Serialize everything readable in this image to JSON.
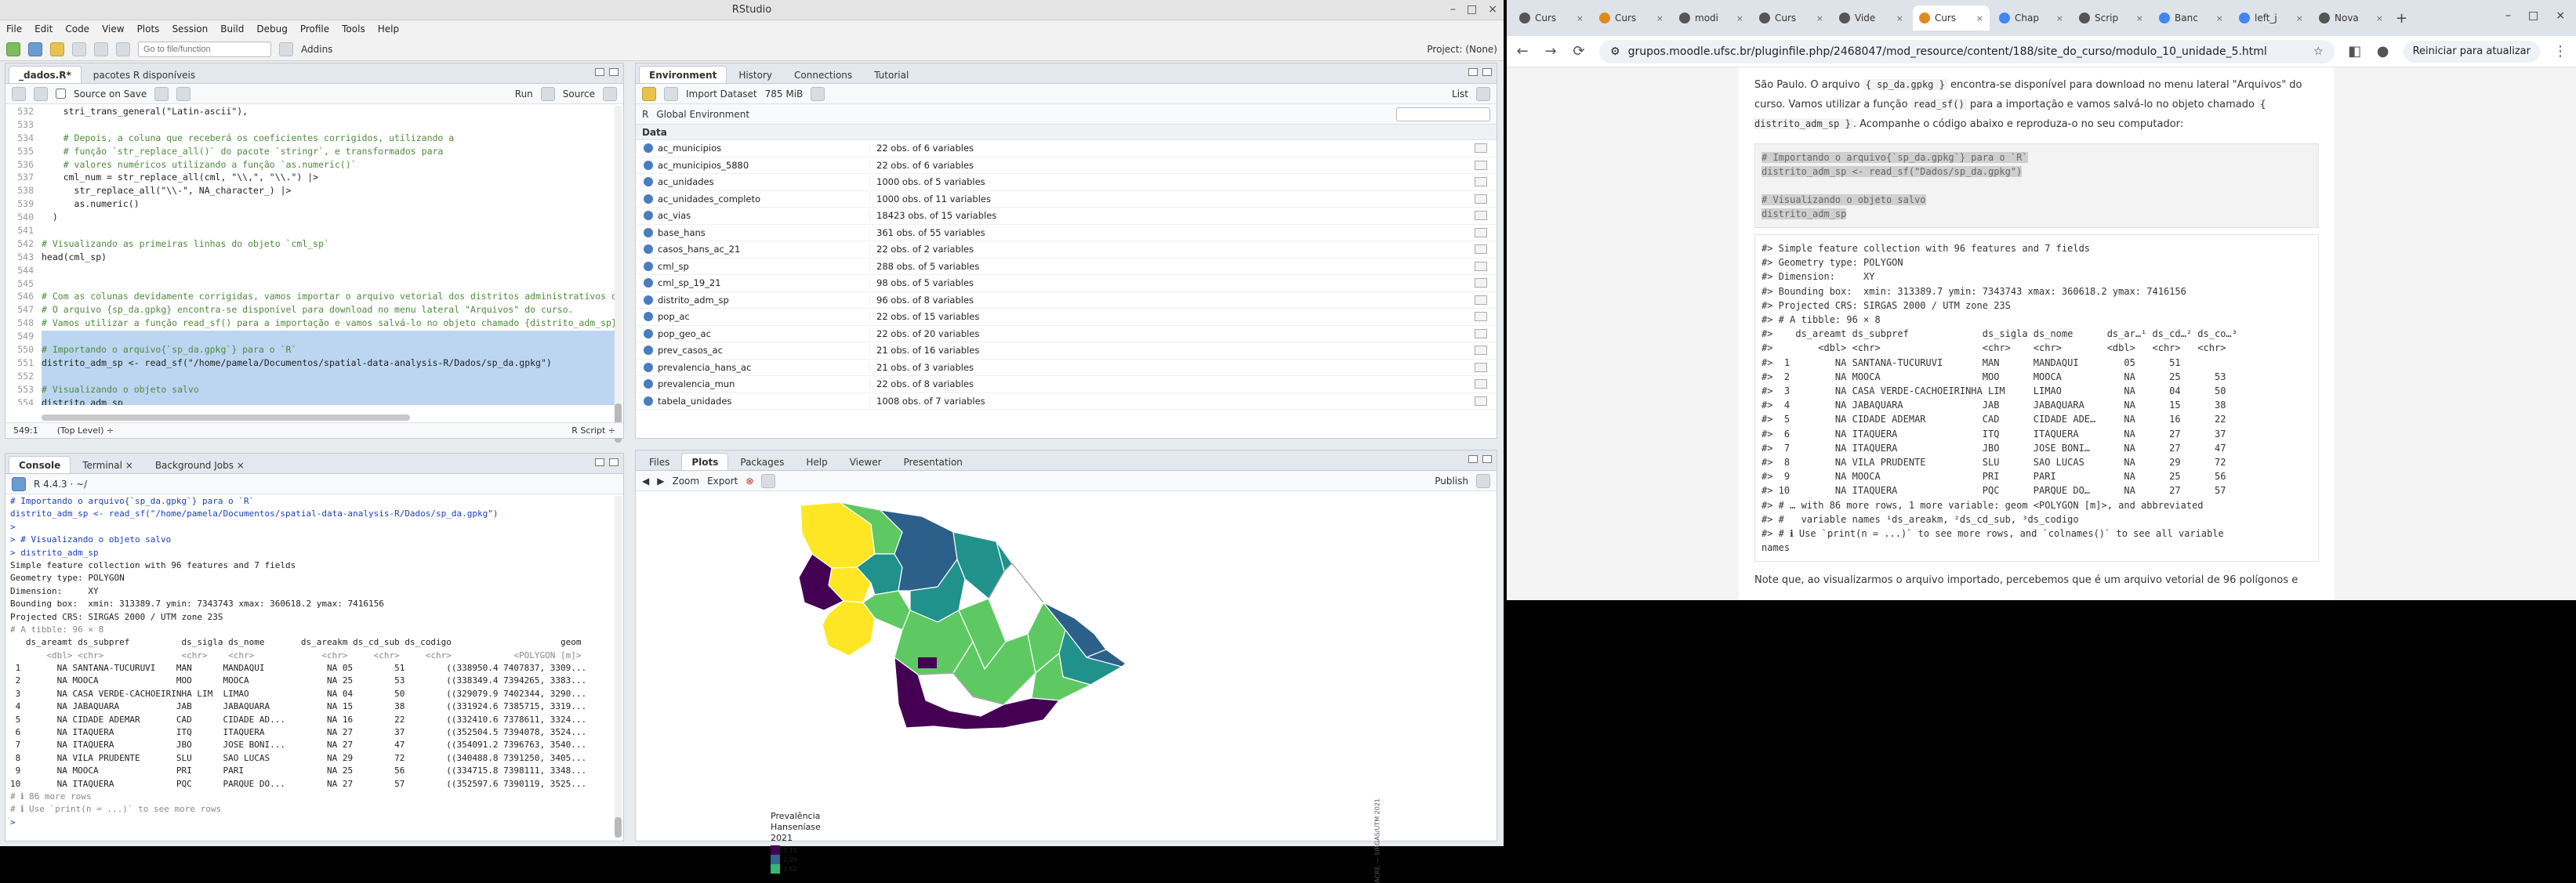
{
  "rstudio": {
    "title": "RStudio",
    "menu": [
      "File",
      "Edit",
      "Code",
      "View",
      "Plots",
      "Session",
      "Build",
      "Debug",
      "Profile",
      "Tools",
      "Help"
    ],
    "toolbar": {
      "goto_placeholder": "Go to file/function",
      "addins": "Addins",
      "project": "Project: (None)"
    },
    "editor": {
      "tabs": [
        "_dados.R*",
        "pacotes R disponíveis"
      ],
      "source_on_save": "Source on Save",
      "run": "Run",
      "source": "Source",
      "lines": [
        {
          "n": "532",
          "t": "    stri_trans_general(\"Latin-ascii\"),",
          "c": ""
        },
        {
          "n": "533",
          "t": "",
          "c": ""
        },
        {
          "n": "534",
          "t": "    # Depois, a coluna que receberá os coeficientes corrigidos, utilizando a",
          "c": "cm"
        },
        {
          "n": "535",
          "t": "    # função `str_replace_all()` do pacote `stringr`, e transformados para",
          "c": "cm"
        },
        {
          "n": "536",
          "t": "    # valores numéricos utilizando a função `as.numeric()`",
          "c": "cm"
        },
        {
          "n": "537",
          "t": "    cml_num = str_replace_all(cml, \"\\\\,\", \"\\\\.\") |>",
          "c": ""
        },
        {
          "n": "538",
          "t": "      str_replace_all(\"\\\\-\", NA_character_) |>",
          "c": ""
        },
        {
          "n": "539",
          "t": "      as.numeric()",
          "c": ""
        },
        {
          "n": "540",
          "t": "  )",
          "c": ""
        },
        {
          "n": "541",
          "t": "",
          "c": ""
        },
        {
          "n": "542",
          "t": "# Visualizando as primeiras linhas do objeto `cml_sp`",
          "c": "cm"
        },
        {
          "n": "543",
          "t": "head(cml_sp)",
          "c": ""
        },
        {
          "n": "544",
          "t": "",
          "c": ""
        },
        {
          "n": "545",
          "t": "",
          "c": ""
        },
        {
          "n": "546",
          "t": "# Com as colunas devidamente corrigidas, vamos importar o arquivo vetorial dos distritos administrativos de S",
          "c": "cm"
        },
        {
          "n": "547",
          "t": "# O arquivo {sp_da.gpkg} encontra-se disponível para download no menu lateral \"Arquivos\" do curso.",
          "c": "cm"
        },
        {
          "n": "548",
          "t": "# Vamos utilizar a função read_sf() para a importação e vamos salvá-lo no objeto chamado {distrito_adm_sp}.",
          "c": "cm"
        },
        {
          "n": "549",
          "t": "",
          "c": "sel"
        },
        {
          "n": "550",
          "t": "# Importando o arquivo{`sp_da.gpkg`} para o `R`",
          "c": "sel cm"
        },
        {
          "n": "551",
          "t": "distrito_adm_sp <- read_sf(\"/home/pamela/Documentos/spatial-data-analysis-R/Dados/sp_da.gpkg\")",
          "c": "sel"
        },
        {
          "n": "552",
          "t": "",
          "c": "sel"
        },
        {
          "n": "553",
          "t": "# Visualizando o objeto salvo",
          "c": "sel cm"
        },
        {
          "n": "554",
          "t": "distrito_adm_sp",
          "c": "sel"
        },
        {
          "n": "555",
          "t": "",
          "c": ""
        }
      ],
      "status_pos": "549:1",
      "status_level": "(Top Level) ÷",
      "status_type": "R Script ÷"
    },
    "console": {
      "tabs": [
        "Console",
        "Terminal ×",
        "Background Jobs ×"
      ],
      "version": "R 4.4.3 · ~/",
      "lines": [
        {
          "t": "# Importando o arquivo{`sp_da.gpkg`} para o `R`",
          "k": "cmd"
        },
        {
          "t": "distrito_adm_sp <- read_sf(\"/home/pamela/Documentos/spatial-data-analysis-R/Dados/sp_da.gpkg\")",
          "k": "cmd"
        },
        {
          "t": ">",
          "k": "cmd"
        },
        {
          "t": "> # Visualizando o objeto salvo",
          "k": "cmd"
        },
        {
          "t": "> distrito_adm_sp",
          "k": "cmd"
        },
        {
          "t": "Simple feature collection with 96 features and 7 fields",
          "k": ""
        },
        {
          "t": "Geometry type: POLYGON",
          "k": ""
        },
        {
          "t": "Dimension:     XY",
          "k": ""
        },
        {
          "t": "Bounding box:  xmin: 313389.7 ymin: 7343743 xmax: 360618.2 ymax: 7416156",
          "k": ""
        },
        {
          "t": "Projected CRS: SIRGAS 2000 / UTM zone 23S",
          "k": ""
        },
        {
          "t": "# A tibble: 96 × 8",
          "k": "dim"
        },
        {
          "t": "   ds_areamt ds_subpref          ds_sigla ds_nome       ds_areakm ds_cd_sub ds_codigo                     geom",
          "k": ""
        },
        {
          "t": "       <dbl> <chr>               <chr>    <chr>             <chr>     <chr>     <chr>            <POLYGON [m]>",
          "k": "dim"
        },
        {
          "t": " 1       NA SANTANA-TUCURUVI    MAN      MANDAQUI            NA 05        51        ((338950.4 7407837, 3309...",
          "k": ""
        },
        {
          "t": " 2       NA MOOCA               MOO      MOOCA               NA 25        53        ((338349.4 7394265, 3383...",
          "k": ""
        },
        {
          "t": " 3       NA CASA VERDE-CACHOEIRINHA LIM  LIMAO               NA 04        50        ((329079.9 7402344, 3290...",
          "k": ""
        },
        {
          "t": " 4       NA JABAQUARA           JAB      JABAQUARA           NA 15        38        ((331924.6 7385715, 3319...",
          "k": ""
        },
        {
          "t": " 5       NA CIDADE ADEMAR       CAD      CIDADE AD...        NA 16        22        ((332410.6 7378611, 3324...",
          "k": ""
        },
        {
          "t": " 6       NA ITAQUERA            ITQ      ITAQUERA            NA 27        37        ((352504.5 7394078, 3524...",
          "k": ""
        },
        {
          "t": " 7       NA ITAQUERA            JBO      JOSE BONI...        NA 27        47        ((354091.2 7396763, 3540...",
          "k": ""
        },
        {
          "t": " 8       NA VILA PRUDENTE       SLU      SAO LUCAS           NA 29        72        ((340488.8 7391250, 3405...",
          "k": ""
        },
        {
          "t": " 9       NA MOOCA               PRI      PARI                NA 25        56        ((334715.8 7398111, 3348...",
          "k": ""
        },
        {
          "t": "10       NA ITAQUERA            PQC      PARQUE DO...        NA 27        57        ((352597.6 7390119, 3525...",
          "k": ""
        },
        {
          "t": "# ℹ 86 more rows",
          "k": "dim"
        },
        {
          "t": "# ℹ Use `print(n = ...)` to see more rows",
          "k": "dim"
        },
        {
          "t": ">",
          "k": "cmd"
        }
      ]
    },
    "environment": {
      "tabs": [
        "Environment",
        "History",
        "Connections",
        "Tutorial"
      ],
      "import_dataset": "Import Dataset",
      "memory": "785 MiB",
      "list_view": "List",
      "r_selector": "R",
      "scope": "Global Environment",
      "section": "Data",
      "rows": [
        {
          "name": "ac_municipios",
          "value": "22 obs. of 6 variables"
        },
        {
          "name": "ac_municipios_5880",
          "value": "22 obs. of 6 variables"
        },
        {
          "name": "ac_unidades",
          "value": "1000 obs. of 5 variables"
        },
        {
          "name": "ac_unidades_completo",
          "value": "1000 obs. of 11 variables"
        },
        {
          "name": "ac_vias",
          "value": "18423 obs. of 15 variables"
        },
        {
          "name": "base_hans",
          "value": "361 obs. of 55 variables"
        },
        {
          "name": "casos_hans_ac_21",
          "value": "22 obs. of 2 variables"
        },
        {
          "name": "cml_sp",
          "value": "288 obs. of 5 variables"
        },
        {
          "name": "cml_sp_19_21",
          "value": "98 obs. of 5 variables"
        },
        {
          "name": "distrito_adm_sp",
          "value": "96 obs. of 8 variables"
        },
        {
          "name": "pop_ac",
          "value": "22 obs. of 15 variables"
        },
        {
          "name": "pop_geo_ac",
          "value": "22 obs. of 20 variables"
        },
        {
          "name": "prev_casos_ac",
          "value": "21 obs. of 16 variables"
        },
        {
          "name": "prevalencia_hans_ac",
          "value": "21 obs. of 3 variables"
        },
        {
          "name": "prevalencia_mun",
          "value": "22 obs. of 8 variables"
        },
        {
          "name": "tabela_unidades",
          "value": "1008 obs. of 7 variables"
        }
      ]
    },
    "plots": {
      "tabs": [
        "Files",
        "Plots",
        "Packages",
        "Help",
        "Viewer",
        "Presentation"
      ],
      "zoom": "Zoom",
      "export": "Export",
      "publish": "Publish",
      "legend_title": [
        "Prevalência",
        "Hanseníase",
        "2021"
      ],
      "legend_items": [
        {
          "label": "3.15",
          "color": "#440154"
        },
        {
          "label": "2.95",
          "color": "#31688e"
        },
        {
          "label": "2.52",
          "color": "#35b779"
        }
      ],
      "credit": "ACRE — SIRGAS/UTM 2021",
      "colors": {
        "purple": "#440154",
        "blue": "#2c5f8a",
        "teal": "#21918c",
        "green": "#5ec962",
        "yellow": "#fde725",
        "white": "#ffffff"
      }
    }
  },
  "chrome": {
    "tabs": [
      {
        "label": "Curs",
        "icon": "github"
      },
      {
        "label": "Curs",
        "icon": "moodle"
      },
      {
        "label": "modi",
        "icon": "github"
      },
      {
        "label": "Curs",
        "icon": "github"
      },
      {
        "label": "Vide",
        "icon": "video"
      },
      {
        "label": "Curs",
        "icon": "moodle"
      },
      {
        "label": "Chap",
        "icon": "doc"
      },
      {
        "label": "Scrip",
        "icon": "github"
      },
      {
        "label": "Banc",
        "icon": "doc"
      },
      {
        "label": "left_j",
        "icon": "google"
      },
      {
        "label": "Nova",
        "icon": "chrome"
      }
    ],
    "url": "grupos.moodle.ufsc.br/pluginfile.php/2468047/mod_resource/content/188/site_do_curso/modulo_10_unidade_5.html",
    "update_button": "Reiniciar para atualizar",
    "page": {
      "para1_a": "São Paulo. O arquivo ",
      "para1_code": "{ sp_da.gpkg }",
      "para1_b": " encontra-se disponível para download no menu lateral \"Arquivos\" do curso. Vamos utilizar a função ",
      "para1_code2": "read_sf()",
      "para1_c": " para a importação e vamos salvá-lo no objeto chamado ",
      "para1_code3": "{ distrito_adm_sp }",
      "para1_d": ". Acompanhe o código abaixo e reproduza-o no seu computador:",
      "code_lines": [
        "# Importando o arquivo{`sp_da.gpkg`} para o `R`",
        "distrito_adm_sp <- read_sf(\"Dados/sp_da.gpkg\")",
        "",
        "# Visualizando o objeto salvo",
        "distrito_adm_sp"
      ],
      "output_lines": [
        "#> Simple feature collection with 96 features and 7 fields",
        "#> Geometry type: POLYGON",
        "#> Dimension:     XY",
        "#> Bounding box:  xmin: 313389.7 ymin: 7343743 xmax: 360618.2 ymax: 7416156",
        "#> Projected CRS: SIRGAS 2000 / UTM zone 23S",
        "#> # A tibble: 96 × 8",
        "#>    ds_areamt ds_subpref             ds_sigla ds_nome      ds_ar…¹ ds_cd…² ds_co…³",
        "#>        <dbl> <chr>                  <chr>    <chr>        <dbl>   <chr>   <chr>",
        "#>  1        NA SANTANA-TUCURUVI       MAN      MANDAQUI        05      51",
        "#>  2        NA MOOCA                  MOO      MOOCA           NA      25      53",
        "#>  3        NA CASA VERDE-CACHOEIRINHA LIM     LIMAO           NA      04      50",
        "#>  4        NA JABAQUARA              JAB      JABAQUARA       NA      15      38",
        "#>  5        NA CIDADE ADEMAR          CAD      CIDADE ADE…     NA      16      22",
        "#>  6        NA ITAQUERA               ITQ      ITAQUERA        NA      27      37",
        "#>  7        NA ITAQUERA               JBO      JOSE BONI…      NA      27      47",
        "#>  8        NA VILA PRUDENTE          SLU      SAO LUCAS       NA      29      72",
        "#>  9        NA MOOCA                  PRI      PARI            NA      25      56",
        "#> 10        NA ITAQUERA               PQC      PARQUE DO…      NA      27      57",
        "#> # … with 86 more rows, 1 more variable: geom <POLYGON [m]>, and abbreviated",
        "#> #   variable names ¹ds_areakm, ²ds_cd_sub, ³ds_codigo",
        "#> # ℹ Use `print(n = ...)` to see more rows, and `colnames()` to see all variable",
        "names"
      ],
      "para2": "Note que, ao visualizarmos o arquivo importado, percebemos que é um arquivo vetorial de 96 polígonos e"
    }
  }
}
